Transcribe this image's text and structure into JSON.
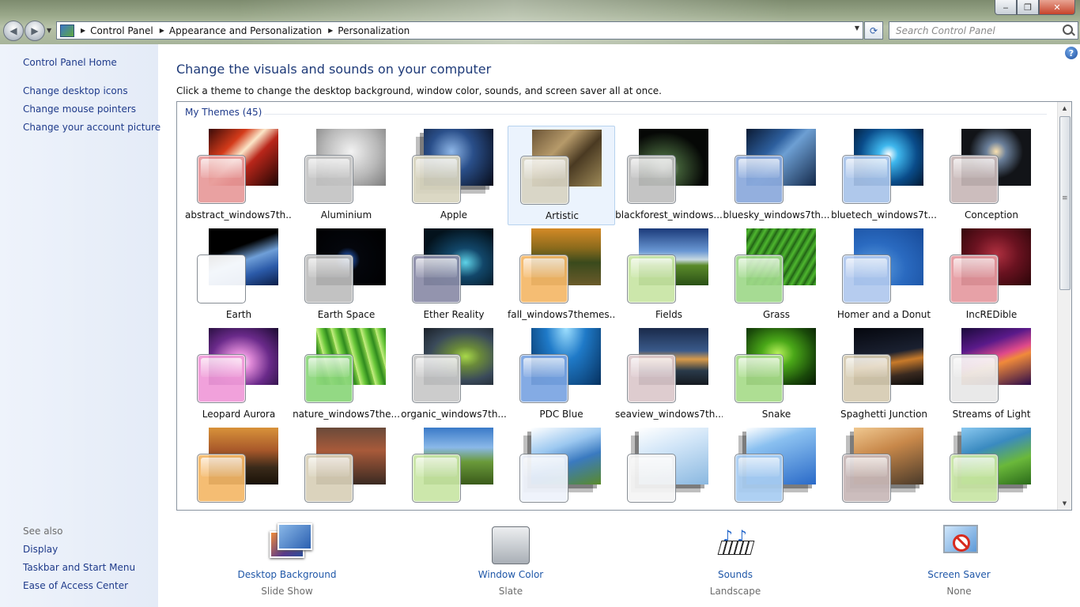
{
  "window": {
    "min_glyph": "‒",
    "max_glyph": "❐",
    "close_glyph": "✕"
  },
  "nav": {
    "back_glyph": "◀",
    "forward_glyph": "▶",
    "recent_glyph": "▼",
    "refresh_glyph": "⟳"
  },
  "address": {
    "sep_glyph": "▶",
    "crumbs": [
      "Control Panel",
      "Appearance and Personalization",
      "Personalization"
    ],
    "drop_glyph": "▼"
  },
  "search": {
    "placeholder": "Search Control Panel"
  },
  "sidebar": {
    "home": "Control Panel Home",
    "tasks": [
      "Change desktop icons",
      "Change mouse pointers",
      "Change your account picture"
    ],
    "see_also_label": "See also",
    "see_also": [
      "Display",
      "Taskbar and Start Menu",
      "Ease of Access Center"
    ]
  },
  "help_glyph": "?",
  "main": {
    "heading": "Change the visuals and sounds on your computer",
    "subtitle": "Click a theme to change the desktop background, window color, sounds, and screen saver all at once.",
    "group_label": "My Themes (45)",
    "scroll_up_glyph": "▲",
    "scroll_down_glyph": "▼"
  },
  "themes": [
    {
      "name": "abstract_windows7th...",
      "image": "linear-gradient(135deg,#3a0b08 0%,#d43b1a 30%,#fbe6c8 45%,#b9261a 60%,#200503 100%)",
      "swatch": "#e89a9a",
      "stack": false,
      "selected": false
    },
    {
      "name": "Aluminium",
      "image": "radial-gradient(ellipse at 50% 40%,#f2f2f2 0%,#b8b8b8 55%,#7d7d7d 100%)",
      "swatch": "#c4c4c4",
      "stack": false,
      "selected": false
    },
    {
      "name": "Apple",
      "image": "radial-gradient(circle at 40% 40%,#8fb7e8 0%,#2a4f8a 40%,#070b18 100%)",
      "swatch": "#d9d5bf",
      "stack": true,
      "selected": false
    },
    {
      "name": "Artistic",
      "image": "linear-gradient(135deg,#6b5436 0%,#b69a6a 35%,#4a3a22 60%,#9e8a58 100%)",
      "swatch": "#d8d4c3",
      "stack": false,
      "selected": true
    },
    {
      "name": "blackforest_windows...",
      "image": "radial-gradient(ellipse at 35% 70%,#d9ecd0 0%,#3e5a35 25%,#060806 65%)",
      "swatch": "#bfbfbf",
      "stack": false,
      "selected": false
    },
    {
      "name": "bluesky_windows7th...",
      "image": "linear-gradient(135deg,#0b1a33 0%,#2d5f9e 35%,#6d9fd3 50%,#14294a 100%)",
      "swatch": "#8aa9dc",
      "stack": false,
      "selected": false
    },
    {
      "name": "bluetech_windows7t...",
      "image": "radial-gradient(circle at 50% 45%,#ffffff 0%,#3fb8ee 20%,#0a4c8a 60%,#021830 100%)",
      "swatch": "#a9c4ea",
      "stack": false,
      "selected": false
    },
    {
      "name": "Conception",
      "image": "radial-gradient(circle at 50% 40%,#fbe1b0 0%,#6a7f9a 20%,#121418 55%)",
      "swatch": "#c8b8b8",
      "stack": false,
      "selected": false
    },
    {
      "name": "Earth",
      "image": "linear-gradient(160deg,#000 0%,#000 35%,#6f9fd8 55%,#2b5aa8 75%,#0b1e48 100%)",
      "swatch": "#ffffff",
      "stack": false,
      "selected": false
    },
    {
      "name": "Earth Space",
      "image": "radial-gradient(circle at 45% 55%,#4a87d8 0%,#173a7a 12%,#04060c 25%,#000 100%)",
      "swatch": "#bdbdbd",
      "stack": false,
      "selected": false
    },
    {
      "name": "Ether Reality",
      "image": "radial-gradient(ellipse at 60% 60%,#5fd3e8 0%,#12476a 30%,#03121c 75%)",
      "swatch": "#8a8ca8",
      "stack": false,
      "selected": false
    },
    {
      "name": "fall_windows7themes...",
      "image": "linear-gradient(180deg,#d48a26 0%,#8a6a1c 35%,#3a4a1c 60%,#6a5a2a 100%)",
      "swatch": "#f5b868",
      "stack": false,
      "selected": false
    },
    {
      "name": "Fields",
      "image": "linear-gradient(180deg,#1b3a7a 0%,#6a98d4 40%,#c7d8e0 55%,#5a8a2a 65%,#2a5016 100%)",
      "swatch": "#c8e6a4",
      "stack": false,
      "selected": false
    },
    {
      "name": "Grass",
      "image": "repeating-linear-gradient(120deg,#2d7a1e 0px,#4fb82f 4px,#1d5a12 9px)",
      "swatch": "#9fd98a",
      "stack": false,
      "selected": false
    },
    {
      "name": "Homer and a Donut",
      "image": "radial-gradient(ellipse at 30% 70%,#5fa0e0 0%,#2a6ac0 45%,#174a98 100%)",
      "swatch": "#b0c8ee",
      "stack": false,
      "selected": false
    },
    {
      "name": "IncREDible",
      "image": "radial-gradient(ellipse at 50% 45%,#b03040 0%,#6a1220 45%,#2a0508 100%)",
      "swatch": "#e69aa0",
      "stack": false,
      "selected": false
    },
    {
      "name": "Leopard Aurora",
      "image": "radial-gradient(ellipse at 45% 60%,#ffffff 0%,#e08ad8 20%,#6a2a8a 55%,#1a0a30 100%)",
      "swatch": "#f09ad8",
      "stack": false,
      "selected": false
    },
    {
      "name": "nature_windows7the...",
      "image": "repeating-linear-gradient(75deg,#cdf088 0px,#6ac83a 6px,#2f8a1e 12px,#8ad04a 18px)",
      "swatch": "#8ad67a",
      "stack": false,
      "selected": false
    },
    {
      "name": "organic_windows7th...",
      "image": "radial-gradient(ellipse at 60% 50%,#a8d84a 0%,#6a8a3a 25%,#3a4a5a 60%,#1a2028 100%)",
      "swatch": "#c8c8c8",
      "stack": false,
      "selected": false
    },
    {
      "name": "PDC Blue",
      "image": "radial-gradient(ellipse at 50% 0%,#9fe0ff 0%,#1f7ac8 40%,#06305e 100%)",
      "swatch": "#7aa4e2",
      "stack": false,
      "selected": false
    },
    {
      "name": "seaview_windows7th...",
      "image": "linear-gradient(180deg,#1a2a4a 0%,#3a5a8a 40%,#d89a4a 55%,#2a3a4a 75%,#151a20 100%)",
      "swatch": "#dcc8cc",
      "stack": false,
      "selected": false
    },
    {
      "name": "Snake",
      "image": "radial-gradient(ellipse at 45% 45%,#b8f05a 0%,#4aa818 30%,#1a4a0a 70%,#061a02 100%)",
      "swatch": "#a8dc8a",
      "stack": false,
      "selected": false
    },
    {
      "name": "Spaghetti Junction",
      "image": "linear-gradient(170deg,#05070e 0%,#1a2030 45%,#c87a2a 60%,#3a2a20 80%,#0a0a0a 100%)",
      "swatch": "#d6ccb2",
      "stack": false,
      "selected": false
    },
    {
      "name": "Streams of Light",
      "image": "linear-gradient(160deg,#1a0a3a 0%,#5a1a8a 30%,#e04a8a 50%,#f08a3a 60%,#2a0a4a 100%)",
      "swatch": "#e8e8e8",
      "stack": false,
      "selected": false
    },
    {
      "name": "",
      "image": "linear-gradient(180deg,#d8923a 0%,#a8582a 40%,#3a2a1a 70%,#1a1208 100%)",
      "swatch": "#f5b868",
      "stack": false,
      "selected": false
    },
    {
      "name": "",
      "image": "linear-gradient(180deg,#6a4a3a 0%,#a85a3a 40%,#3a2a22 100%)",
      "swatch": "#d8d0b8",
      "stack": false,
      "selected": false
    },
    {
      "name": "",
      "image": "linear-gradient(180deg,#3a7ac8 0%,#8ab8e8 35%,#6a9a3a 60%,#3a5a1a 100%)",
      "swatch": "#c8e6a4",
      "stack": false,
      "selected": false
    },
    {
      "name": "",
      "image": "linear-gradient(160deg,#ffffff 0%,#9cc8f0 35%,#3a7ac0 60%,#5a8a2a 100%)",
      "swatch": "#eef3fb",
      "stack": true,
      "selected": false
    },
    {
      "name": "",
      "image": "linear-gradient(160deg,#ffffff 0%,#cfe4f7 40%,#8ab8e0 100%)",
      "swatch": "#f5f5f5",
      "stack": true,
      "selected": false
    },
    {
      "name": "",
      "image": "linear-gradient(160deg,#ffffff 0%,#8ac0f0 30%,#2a6ac8 100%)",
      "swatch": "#a8cdf2",
      "stack": true,
      "selected": false
    },
    {
      "name": "",
      "image": "linear-gradient(160deg,#f0c890 0%,#c8884a 40%,#4a3a2a 100%)",
      "swatch": "#c8b8b8",
      "stack": true,
      "selected": false
    },
    {
      "name": "",
      "image": "linear-gradient(160deg,#8ac8f0 0%,#3a8ac0 35%,#6ab83a 65%,#2a6a1a 100%)",
      "swatch": "#c8e6a4",
      "stack": true,
      "selected": false
    }
  ],
  "options": [
    {
      "label": "Desktop Background",
      "value": "Slide Show"
    },
    {
      "label": "Window Color",
      "value": "Slate"
    },
    {
      "label": "Sounds",
      "value": "Landscape"
    },
    {
      "label": "Screen Saver",
      "value": "None"
    }
  ],
  "sounds_note_glyph": "♪"
}
